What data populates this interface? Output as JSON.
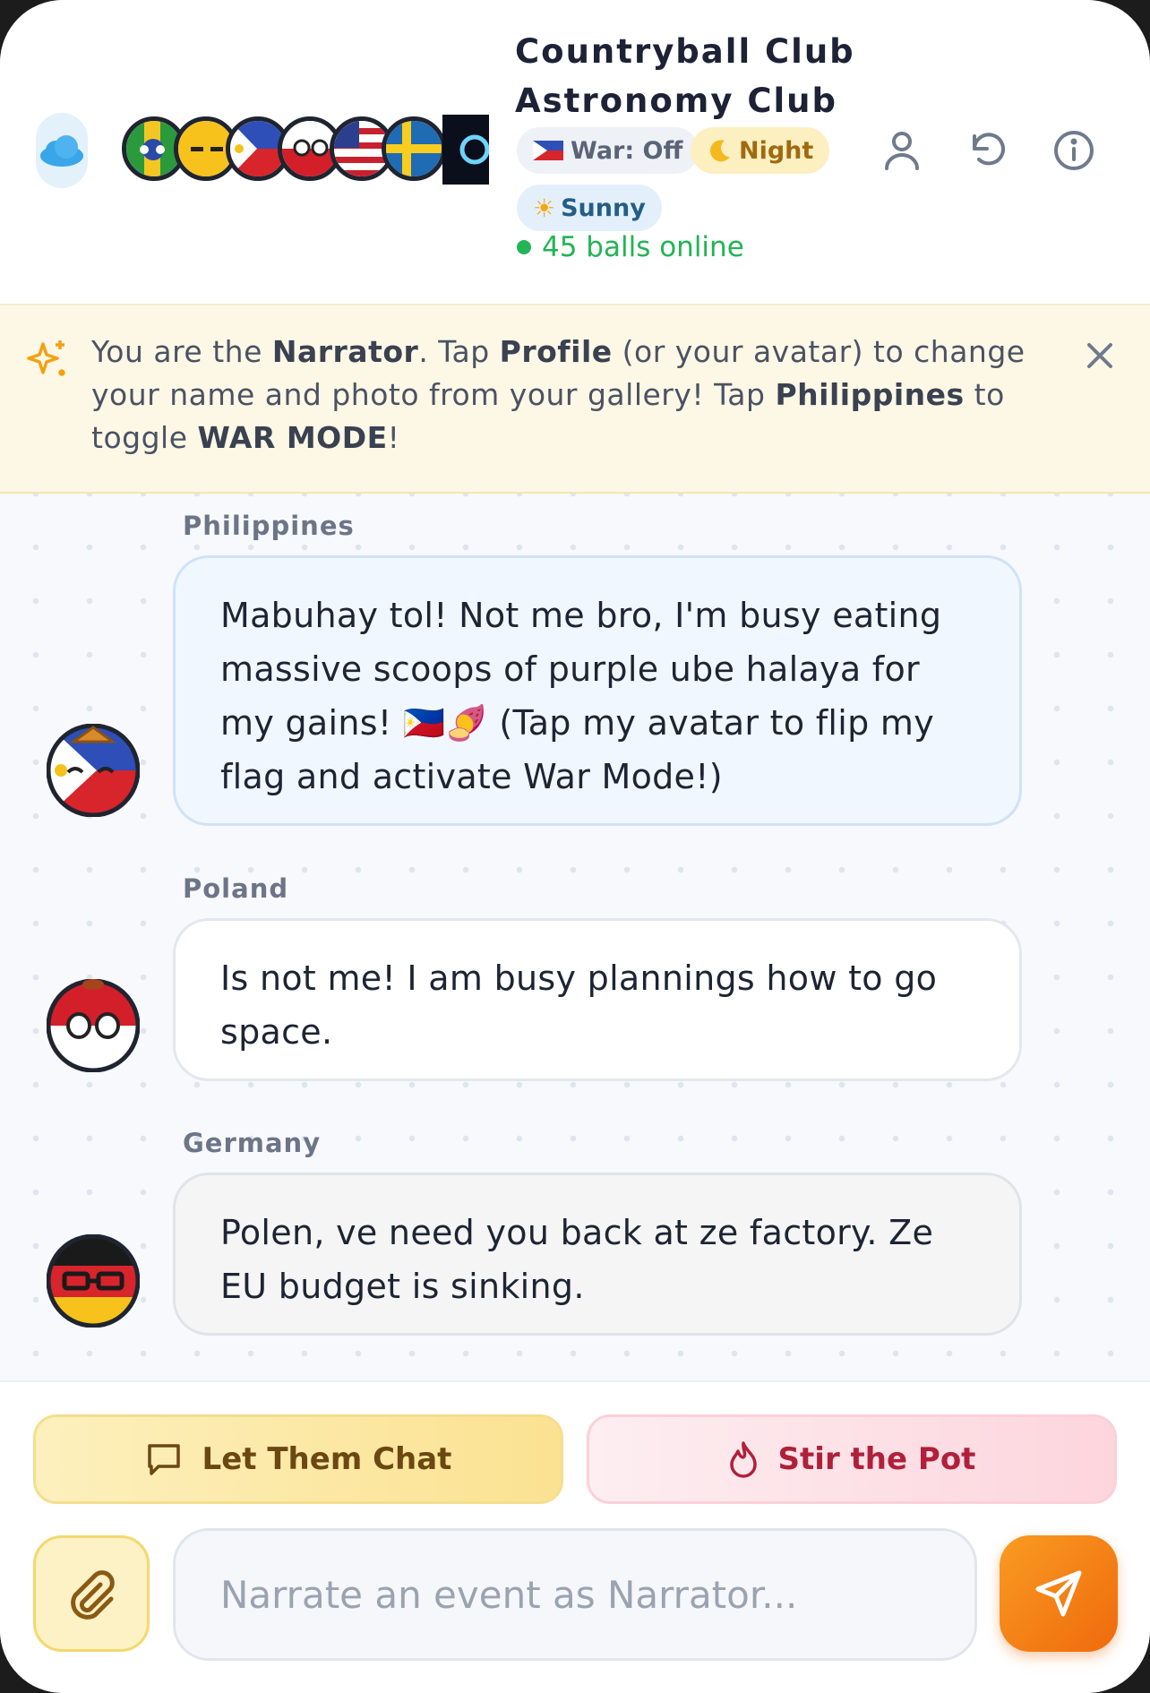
{
  "header": {
    "title_line1": "Countryball Club",
    "title_line2": "Astronomy Club",
    "chips": {
      "war": "War: Off",
      "night": "Night",
      "sunny": "Sunny"
    },
    "online": "45 balls online",
    "icons": [
      "cloud-icon",
      "user-icon",
      "refresh-icon",
      "info-icon"
    ]
  },
  "banner": {
    "part1": "You are the ",
    "narrator": "Narrator",
    "part2": ". Tap ",
    "profile": "Profile",
    "part3": " (or your avatar) to change your name and photo from your gallery! Tap ",
    "philippines": "Philippines",
    "part4": " to toggle ",
    "war_mode": "WAR MODE",
    "part5": "!"
  },
  "messages": [
    {
      "sender": "Philippines",
      "text": "Mabuhay tol! Not me bro, I'm busy eating massive scoops of purple ube halaya for my gains! 🇵🇭🍠 (Tap my avatar to flip my flag and activate War Mode!)"
    },
    {
      "sender": "Poland",
      "text": "Is not me! I am busy plannings how to go space."
    },
    {
      "sender": "Germany",
      "text": "Polen, ve need you back at ze factory. Ze EU budget is sinking."
    }
  ],
  "actions": {
    "let_them_chat": "Let Them Chat",
    "stir_the_pot": "Stir the Pot"
  },
  "composer": {
    "placeholder": "Narrate an event as Narrator..."
  },
  "colors": {
    "accent_orange": "#ef6a0c",
    "online_green": "#22b455",
    "banner_bg": "#fdf8e6"
  }
}
